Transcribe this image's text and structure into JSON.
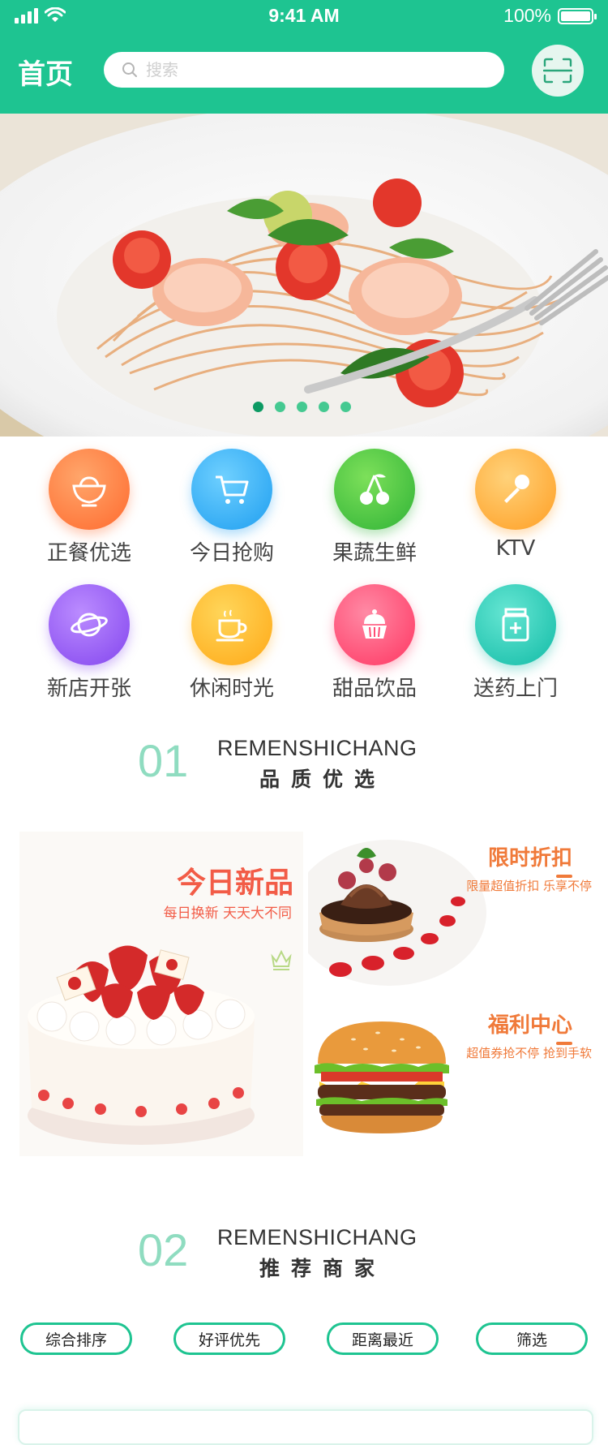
{
  "status_bar": {
    "time": "9:41 AM",
    "battery": "100%"
  },
  "header": {
    "title": "首页",
    "search_placeholder": "搜索"
  },
  "banner": {
    "slide_count": 5,
    "active_slide": 1
  },
  "categories": [
    {
      "label": "正餐优选",
      "icon": "rice-bowl-icon",
      "color": "#ff7a3d"
    },
    {
      "label": "今日抢购",
      "icon": "cart-icon",
      "color": "#2fb4f5"
    },
    {
      "label": "果蔬生鲜",
      "icon": "cherry-icon",
      "color": "#45c94a"
    },
    {
      "label": "KTV",
      "icon": "microphone-icon",
      "color": "#ffad3b"
    },
    {
      "label": "新店开张",
      "icon": "planet-icon",
      "color": "#9a5ff0"
    },
    {
      "label": "休闲时光",
      "icon": "coffee-cup-icon",
      "color": "#ffb62a"
    },
    {
      "label": "甜品饮品",
      "icon": "cupcake-icon",
      "color": "#ff4d75"
    },
    {
      "label": "送药上门",
      "icon": "medicine-icon",
      "color": "#1ec9b6"
    }
  ],
  "section1": {
    "number": "01",
    "en": "REMENSHICHANG",
    "cn": "品质优选"
  },
  "promo": {
    "left": {
      "title": "今日新品",
      "subtitle": "每日换新   天天大不同"
    },
    "right_top": {
      "title": "限时折扣",
      "desc": "限量超值折扣 乐享不停"
    },
    "right_bottom": {
      "title": "福利中心",
      "desc": "超值券抢不停 抢到手软"
    }
  },
  "section2": {
    "number": "02",
    "en": "REMENSHICHANG",
    "cn": "推荐商家"
  },
  "filters": [
    "综合排序",
    "好评优先",
    "距离最近",
    "筛选"
  ],
  "colors": {
    "brand": "#1ec491",
    "accent_red": "#f25c47",
    "accent_orange": "#f07a3a",
    "section_number": "#8fdcc0"
  }
}
